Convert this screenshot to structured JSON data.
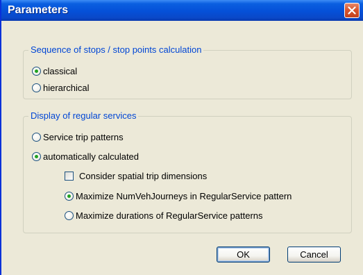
{
  "dialog": {
    "title": "Parameters",
    "close_icon": "close-icon"
  },
  "stops_group": {
    "legend": "Sequence of stops / stop points calculation",
    "options": [
      {
        "label": "classical",
        "selected": true
      },
      {
        "label": "hierarchical",
        "selected": false
      }
    ]
  },
  "services_group": {
    "legend": "Display of regular services",
    "options": [
      {
        "label": "Service trip patterns",
        "selected": false
      },
      {
        "label": "automatically calculated",
        "selected": true
      }
    ],
    "checkbox": {
      "label": "Consider spatial trip dimensions",
      "checked": false
    },
    "sub_options": [
      {
        "label": "Maximize NumVehJourneys in RegularService pattern",
        "selected": true
      },
      {
        "label": "Maximize durations of RegularService patterns",
        "selected": false
      }
    ]
  },
  "buttons": {
    "ok": "OK",
    "cancel": "Cancel"
  },
  "colors": {
    "title_bar": "#0550d8",
    "dialog_bg": "#ece9d8",
    "legend_text": "#0046d5",
    "close_button": "#d9552e",
    "radio_dot": "#21a121"
  }
}
